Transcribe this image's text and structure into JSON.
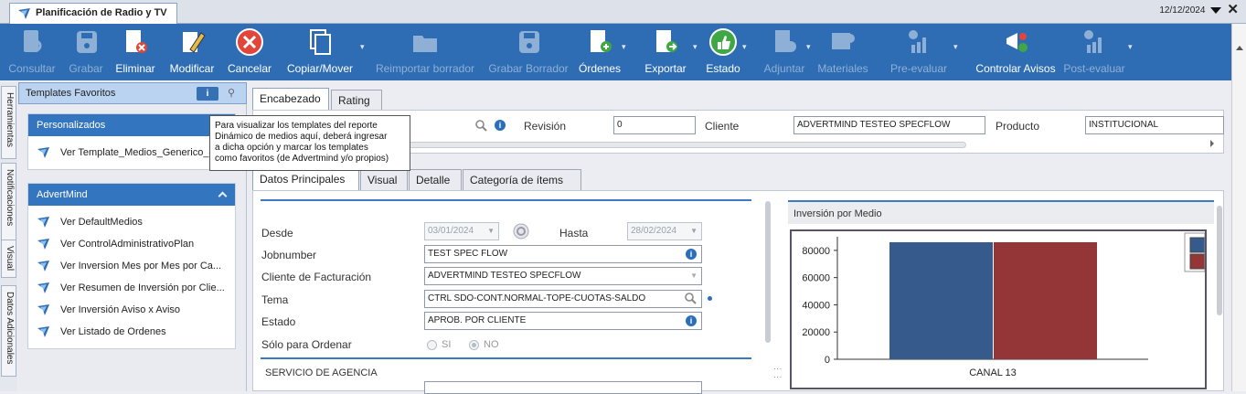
{
  "window": {
    "title": "Planificación de Radio y TV",
    "date": "12/12/2024"
  },
  "toolbar": [
    {
      "label": "Consultar",
      "icon": "search-document-icon",
      "enabled": false
    },
    {
      "label": "Grabar",
      "icon": "save-icon",
      "enabled": false
    },
    {
      "label": "Eliminar",
      "icon": "delete-document-icon",
      "enabled": true
    },
    {
      "label": "Modificar",
      "icon": "edit-icon",
      "enabled": true
    },
    {
      "label": "Cancelar",
      "icon": "cancel-icon",
      "enabled": true
    },
    {
      "label": "Copiar/Mover",
      "icon": "copy-icon",
      "enabled": true
    },
    {
      "label": "Reimportar borrador",
      "icon": "folder-icon",
      "enabled": false
    },
    {
      "label": "Grabar Borrador",
      "icon": "save-draft-icon",
      "enabled": false
    },
    {
      "label": "Órdenes",
      "icon": "orders-icon",
      "enabled": true
    },
    {
      "label": "Exportar",
      "icon": "export-icon",
      "enabled": true
    },
    {
      "label": "Estado",
      "icon": "thumbs-up-icon",
      "enabled": true
    },
    {
      "label": "Adjuntar",
      "icon": "attach-icon",
      "enabled": false
    },
    {
      "label": "Materiales",
      "icon": "materials-icon",
      "enabled": false
    },
    {
      "label": "Pre-evaluar",
      "icon": "pre-evaluate-icon",
      "enabled": false
    },
    {
      "label": "Controlar Avisos",
      "icon": "control-ads-icon",
      "enabled": true
    },
    {
      "label": "Post-evaluar",
      "icon": "post-evaluate-icon",
      "enabled": false
    }
  ],
  "side_tabs": [
    "Herramientas",
    "Notificaciones",
    "Visual",
    "Datos Adicionales"
  ],
  "favorites": {
    "title": "Templates Favoritos",
    "info_label": "i",
    "groups": [
      {
        "name": "Personalizados",
        "items": [
          "Ver Template_Medios_Generico_4"
        ]
      },
      {
        "name": "AdvertMind",
        "items": [
          "Ver DefaultMedios",
          "Ver ControlAdministrativoPlan",
          "Ver Inversion Mes por Mes por Ca...",
          "Ver Resumen de Inversión por Clie...",
          "Ver Inversión Aviso x Aviso",
          "Ver Listado de Ordenes"
        ]
      }
    ]
  },
  "tooltip": {
    "line1": "Para visualizar los templates del reporte",
    "line2": "Dinámico de medios aquí, deberá ingresar",
    "line3": "a dicha opción y marcar los templates",
    "line4": "como favoritos (de Advertmind y/o propios)"
  },
  "header_tabs": [
    "Encabezado",
    "Rating"
  ],
  "header": {
    "revision_label": "Revisión",
    "revision_value": "0",
    "cliente_label": "Cliente",
    "cliente_value": "ADVERTMIND TESTEO SPECFLOW",
    "producto_label": "Producto",
    "producto_value": "INSTITUCIONAL"
  },
  "sub_tabs": [
    "Datos Principales",
    "Visual",
    "Detalle",
    "Categoría de ítems"
  ],
  "form": {
    "desde_label": "Desde",
    "desde_value": "03/01/2024",
    "hasta_label": "Hasta",
    "hasta_value": "28/02/2024",
    "jobnumber_label": "Jobnumber",
    "jobnumber_value": "TEST SPEC FLOW",
    "cliente_fact_label": "Cliente de Facturación",
    "cliente_fact_value": "ADVERTMIND TESTEO SPECFLOW",
    "tema_label": "Tema",
    "tema_value": "CTRL SDO-CONT.NORMAL-TOPE-CUOTAS-SALDO",
    "estado_label": "Estado",
    "estado_value": "APROB. POR CLIENTE",
    "solo_label": "Sólo para Ordenar",
    "si_label": "SI",
    "no_label": "NO",
    "solo_value": "NO",
    "servicio_label": "SERVICIO DE AGENCIA"
  },
  "chart_panel_title": "Inversión por Medio",
  "chart_data": {
    "type": "bar",
    "categories": [
      "CANAL 13"
    ],
    "series": [
      {
        "values": [
          86000
        ],
        "color": "#375a8c"
      },
      {
        "values": [
          86000
        ],
        "color": "#943638"
      }
    ],
    "ylim": [
      0,
      90000
    ],
    "yticks": [
      "0",
      "20000",
      "40000",
      "60000",
      "80000"
    ],
    "legend": [
      "I",
      "I"
    ],
    "legend_position": "right",
    "grid": false
  },
  "colors": {
    "toolbar": "#2e6db3",
    "accent": "#3475bf"
  }
}
